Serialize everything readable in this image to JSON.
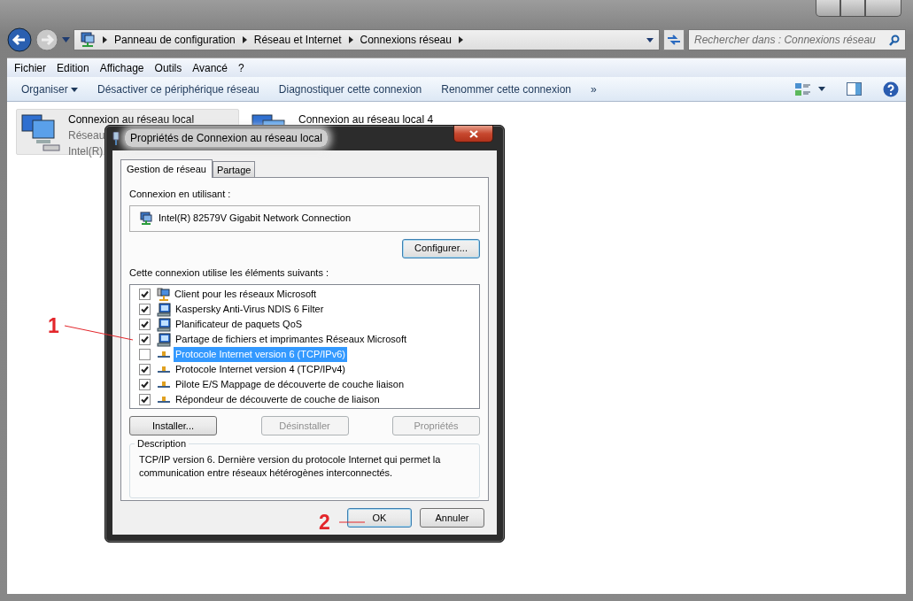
{
  "window": {
    "breadcrumb": [
      "Panneau de configuration",
      "Réseau et Internet",
      "Connexions réseau"
    ],
    "search": {
      "placeholder": "Rechercher dans : Connexions réseau"
    }
  },
  "menu": [
    "Fichier",
    "Edition",
    "Affichage",
    "Outils",
    "Avancé",
    "?"
  ],
  "toolbar": [
    {
      "label": "Organiser",
      "kind": "dropdown"
    },
    {
      "label": "Désactiver ce périphérique réseau",
      "kind": "command"
    },
    {
      "label": "Diagnostiquer cette connexion",
      "kind": "command"
    },
    {
      "label": "Renommer cette connexion",
      "kind": "command"
    },
    {
      "label": "»",
      "kind": "more"
    }
  ],
  "connections": [
    {
      "name": "Connexion au réseau local",
      "lines": [
        "Réseau",
        "Intel(R)"
      ],
      "selected": true
    },
    {
      "name": "Connexion au réseau local 4",
      "selected": false
    }
  ],
  "dialog": {
    "title": "Propriétés de Connexion au réseau local",
    "tabs": [
      {
        "label": "Gestion de réseau",
        "selected": true
      },
      {
        "label": "Partage",
        "selected": false
      }
    ],
    "using_label": "Connexion en utilisant :",
    "adapter": "Intel(R) 82579V Gigabit Network Connection",
    "configure_button": "Configurer...",
    "items_label": "Cette connexion utilise les éléments suivants :",
    "items": [
      {
        "label": "Client pour les réseaux Microsoft",
        "checked": true,
        "selected": false,
        "kind": "client"
      },
      {
        "label": "Kaspersky Anti-Virus NDIS 6 Filter",
        "checked": true,
        "selected": false,
        "kind": "service"
      },
      {
        "label": "Planificateur de paquets QoS",
        "checked": true,
        "selected": false,
        "kind": "service"
      },
      {
        "label": "Partage de fichiers et imprimantes Réseaux Microsoft",
        "checked": true,
        "selected": false,
        "kind": "service"
      },
      {
        "label": "Protocole Internet version 6 (TCP/IPv6)",
        "checked": false,
        "selected": true,
        "kind": "protocol"
      },
      {
        "label": "Protocole Internet version 4 (TCP/IPv4)",
        "checked": true,
        "selected": false,
        "kind": "protocol"
      },
      {
        "label": "Pilote E/S Mappage de découverte de couche liaison",
        "checked": true,
        "selected": false,
        "kind": "protocol"
      },
      {
        "label": "Répondeur de découverte de couche de liaison",
        "checked": true,
        "selected": false,
        "kind": "protocol"
      }
    ],
    "item_buttons": [
      {
        "label": "Installer...",
        "disabled": false
      },
      {
        "label": "Désinstaller",
        "disabled": true
      },
      {
        "label": "Propriétés",
        "disabled": true
      }
    ],
    "description_title": "Description",
    "description": "TCP/IP version 6. Dernière version du protocole Internet qui permet la communication entre réseaux hétérogènes interconnectés.",
    "footer_buttons": [
      {
        "label": "OK",
        "default": true
      },
      {
        "label": "Annuler",
        "default": false
      }
    ]
  },
  "annotations": [
    "1",
    "2"
  ]
}
